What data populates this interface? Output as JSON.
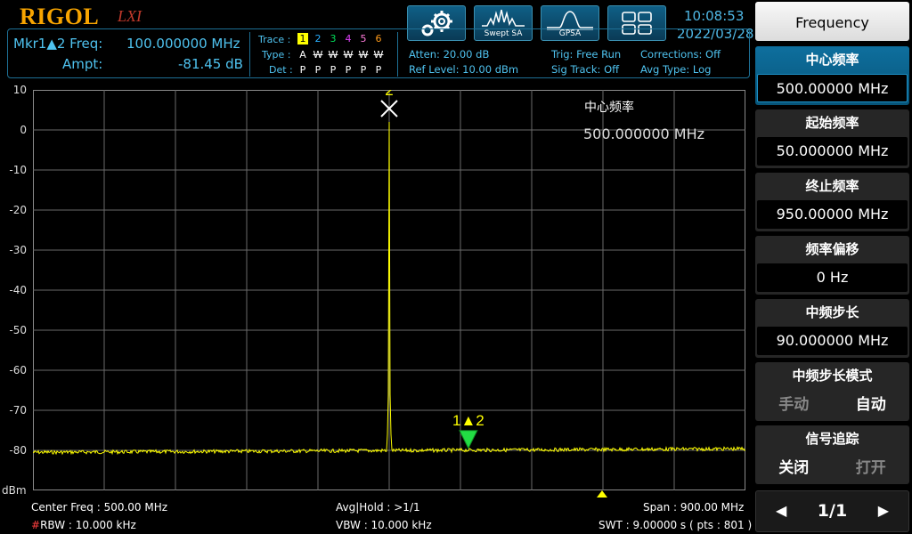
{
  "header": {
    "logo": "RIGOL",
    "logo_suffix": "LXI",
    "mode_buttons": [
      {
        "name": "settings",
        "label": ""
      },
      {
        "name": "swept-sa",
        "label": "Swept SA"
      },
      {
        "name": "gpsa",
        "label": "GPSA"
      },
      {
        "name": "layout",
        "label": ""
      }
    ],
    "time": "10:08:53",
    "date": "2022/03/28"
  },
  "marker": {
    "freq_label": "Mkr1▲2 Freq:",
    "freq_value": "100.000000 MHz",
    "ampt_label": "Ampt:",
    "ampt_value": "-81.45 dB"
  },
  "trace": {
    "trace_label": "Trace :",
    "type_label": "Type :",
    "det_label": "Det :",
    "numbers": [
      "1",
      "2",
      "3",
      "4",
      "5",
      "6"
    ],
    "number_colors": [
      "#ffff00",
      "#2ab0ff",
      "#00e05a",
      "#e040fb",
      "#ff7ad9",
      "#ff9a1a"
    ],
    "types": [
      "A",
      "W",
      "W",
      "W",
      "W",
      "W"
    ],
    "dets": [
      "P",
      "P",
      "P",
      "P",
      "P",
      "P"
    ]
  },
  "settings": {
    "atten": "Atten: 20.00 dB",
    "ref_level": "Ref Level: 10.00 dBm",
    "trig": "Trig: Free Run",
    "sig_track": "Sig Track: Off",
    "corrections": "Corrections: Off",
    "avg_type": "Avg Type: Log"
  },
  "plot": {
    "y_ticks": [
      "10",
      "0",
      "-10",
      "-20",
      "-30",
      "-40",
      "-50",
      "-60",
      "-70",
      "-80"
    ],
    "unit": "dBm",
    "marker2_label": "2",
    "marker_delta_label": "1▲2",
    "annotation_title": "中心频率",
    "annotation_value": "500.000000 MHz"
  },
  "footer": {
    "center_freq": "Center Freq : 500.00 MHz",
    "rbw_prefix": "#",
    "rbw": "RBW : 10.000 kHz",
    "avg_hold": "Avg|Hold : >1/1",
    "vbw": "VBW : 10.000 kHz",
    "span": "Span : 900.00 MHz",
    "swt": "SWT : 9.00000 s ( pts : 801 )"
  },
  "sidebar": {
    "title": "Frequency",
    "items": [
      {
        "label": "中心频率",
        "value": "500.00000 MHz",
        "active": true
      },
      {
        "label": "起始频率",
        "value": "50.000000 MHz"
      },
      {
        "label": "终止频率",
        "value": "950.00000 MHz"
      },
      {
        "label": "频率偏移",
        "value": "0 Hz"
      },
      {
        "label": "中频步长",
        "value": "90.000000 MHz"
      }
    ],
    "step_mode": {
      "label": "中频步长模式",
      "opt1": "手动",
      "opt2": "自动"
    },
    "sig_track": {
      "label": "信号追踪",
      "opt1": "关闭",
      "opt2": "打开"
    },
    "page": "1/1"
  },
  "chart_data": {
    "type": "line",
    "x_start_mhz": 50,
    "x_stop_mhz": 950,
    "ylim": [
      -90,
      10
    ],
    "noise_floor_dbm": -80.5,
    "peaks": [
      {
        "x_mhz": 500,
        "y_dbm": 2
      }
    ],
    "markers": [
      {
        "label": "2",
        "x_mhz": 500,
        "y_dbm": 2
      },
      {
        "label": "1▲2",
        "x_mhz": 600,
        "y_dbm": -79.5
      }
    ],
    "colors": {
      "trace": "#ffff00",
      "marker_delta": "#22dd44",
      "grid": "#6a6a6a"
    }
  }
}
